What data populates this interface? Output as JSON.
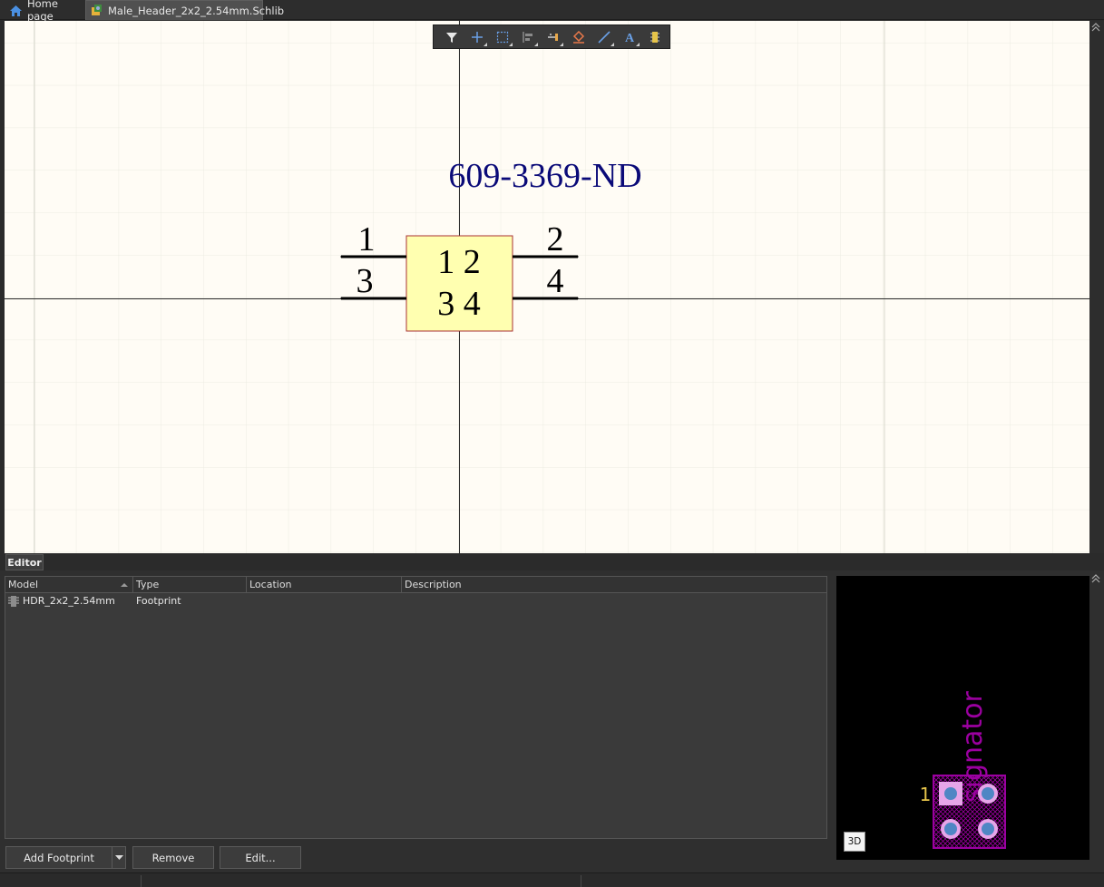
{
  "tabs": [
    {
      "label": "Home page",
      "icon": "home-icon"
    },
    {
      "label": "Male_Header_2x2_2.54mm.Schlib",
      "icon": "schlib-file-icon"
    }
  ],
  "toolbar": {
    "tools": [
      "filter-icon",
      "cross-icon",
      "select-rect-icon",
      "align-icon",
      "pin-icon",
      "fill-icon",
      "line-icon",
      "text-icon",
      "component-icon"
    ]
  },
  "schematic": {
    "comment": "609-3369-ND",
    "body_labels": [
      "1 2",
      "3 4"
    ],
    "pins": [
      "1",
      "2",
      "3",
      "4"
    ],
    "colors": {
      "canvas": "#fffcf5",
      "body_fill": "#ffffb0",
      "body_border": "#a83232",
      "comment_text": "#0a0a78"
    }
  },
  "editor": {
    "tab_label": "Editor",
    "columns": [
      "Model",
      "Type",
      "Location",
      "Description"
    ],
    "rows": [
      {
        "model": "HDR_2x2_2.54mm",
        "type": "Footprint",
        "location": "",
        "description": ""
      }
    ],
    "buttons": {
      "add_footprint": "Add Footprint",
      "remove": "Remove",
      "edit": "Edit..."
    }
  },
  "preview": {
    "designator_text": "signator",
    "pin1_label": "1",
    "btn_3d": "3D",
    "colors": {
      "silk": "#9b00a0",
      "pad": "#4f86c4",
      "pin1": "#e6c44a"
    }
  }
}
